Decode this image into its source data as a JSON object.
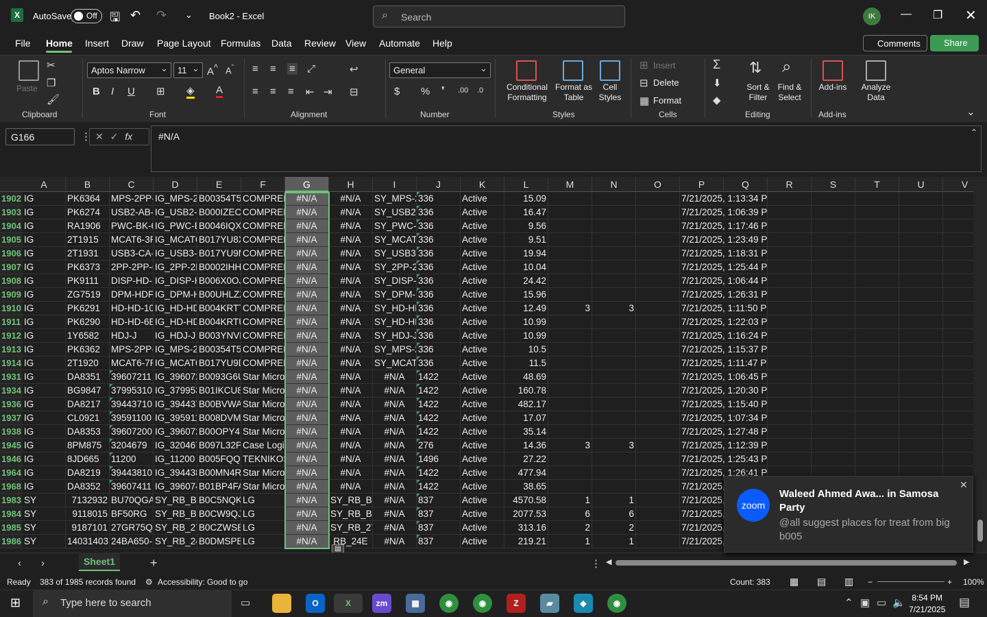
{
  "titlebar": {
    "autosave_label": "AutoSave",
    "autosave_state": "Off",
    "doc_title": "Book2 - Excel",
    "search_placeholder": "Search",
    "avatar_initials": "IK"
  },
  "menu": {
    "items": [
      "File",
      "Home",
      "Insert",
      "Draw",
      "Page Layout",
      "Formulas",
      "Data",
      "Review",
      "View",
      "Automate",
      "Help"
    ],
    "comments": "Comments",
    "share": "Share"
  },
  "ribbon": {
    "clipboard": {
      "label": "Clipboard",
      "paste": "Paste"
    },
    "font": {
      "label": "Font",
      "name": "Aptos Narrow",
      "size": "11"
    },
    "alignment": {
      "label": "Alignment"
    },
    "number": {
      "label": "Number",
      "format": "General"
    },
    "styles": {
      "label": "Styles",
      "conditional": "Conditional Formatting",
      "format_table": "Format as Table",
      "cell_styles": "Cell Styles"
    },
    "cells": {
      "label": "Cells",
      "insert": "Insert",
      "delete": "Delete",
      "format": "Format"
    },
    "editing": {
      "label": "Editing",
      "sort": "Sort & Filter",
      "find": "Find & Select"
    },
    "addins": {
      "label": "Add-ins",
      "addins": "Add-ins",
      "analyze": "Analyze Data"
    }
  },
  "formula_bar": {
    "name_box": "G166",
    "fx": "fx",
    "formula": "#N/A"
  },
  "columns": [
    "A",
    "B",
    "C",
    "D",
    "E",
    "F",
    "G",
    "H",
    "I",
    "J",
    "K",
    "L",
    "M",
    "N",
    "O",
    "P",
    "Q",
    "R",
    "S",
    "T",
    "U",
    "V"
  ],
  "rows": [
    {
      "n": "1902",
      "a": "IG",
      "b": "PK6364",
      "c": "MPS-2PP-2",
      "d": "IG_MPS-2P",
      "e": "B00354T5U",
      "f": "COMPREH",
      "g": "#N/A",
      "h": "#N/A",
      "i": "SY_MPS-2P",
      "j": "336",
      "k": "Active",
      "l": "15.09",
      "m": "",
      "nn": "",
      "p": "7/21/2025, 1:13:34 PM"
    },
    {
      "n": "1903",
      "a": "IG",
      "b": "PK6274",
      "c": "USB2-AB-2",
      "d": "IG_USB2-A",
      "e": "B000IZECH",
      "f": "COMPREH",
      "g": "#N/A",
      "h": "#N/A",
      "i": "SY_USB2-A",
      "j": "336",
      "k": "Active",
      "l": "16.47",
      "m": "",
      "nn": "",
      "p": "7/21/2025, 1:06:39 PM"
    },
    {
      "n": "1904",
      "a": "IG",
      "b": "RA1906",
      "c": "PWC-BK-6",
      "d": "IG_PWC-B",
      "e": "B0046IQXI",
      "f": "COMPREH",
      "g": "#N/A",
      "h": "#N/A",
      "i": "SY_PWC-B",
      "j": "336",
      "k": "Active",
      "l": "9.56",
      "m": "",
      "nn": "",
      "p": "7/21/2025, 1:17:46 PM"
    },
    {
      "n": "1905",
      "a": "IG",
      "b": "2T1915",
      "c": "MCAT6-3P",
      "d": "IG_MCAT6",
      "e": "B017YU8X",
      "f": "COMPREH",
      "g": "#N/A",
      "h": "#N/A",
      "i": "SY_MCAT6",
      "j": "336",
      "k": "Active",
      "l": "9.51",
      "m": "",
      "nn": "",
      "p": "7/21/2025, 1:23:49 PM"
    },
    {
      "n": "1906",
      "a": "IG",
      "b": "2T1931",
      "c": "USB3-CA-1",
      "d": "IG_USB3-C",
      "e": "B017YU9M",
      "f": "COMPREH",
      "g": "#N/A",
      "h": "#N/A",
      "i": "SY_USB3-C",
      "j": "336",
      "k": "Active",
      "l": "19.94",
      "m": "",
      "nn": "",
      "p": "7/21/2025, 1:18:31 PM"
    },
    {
      "n": "1907",
      "a": "IG",
      "b": "PK6373",
      "c": "2PP-2PP-6",
      "d": "IG_2PP-2P",
      "e": "B0002IHHI",
      "f": "COMPREH",
      "g": "#N/A",
      "h": "#N/A",
      "i": "SY_2PP-2P",
      "j": "336",
      "k": "Active",
      "l": "10.04",
      "m": "",
      "nn": "",
      "p": "7/21/2025, 1:25:44 PM"
    },
    {
      "n": "1908",
      "a": "IG",
      "b": "PK9111",
      "c": "DISP-HD-1",
      "d": "IG_DISP-H",
      "e": "B006X0OJ",
      "f": "COMPREH",
      "g": "#N/A",
      "h": "#N/A",
      "i": "SY_DISP-H",
      "j": "336",
      "k": "Active",
      "l": "24.42",
      "m": "",
      "nn": "",
      "p": "7/21/2025, 1:06:44 PM"
    },
    {
      "n": "1909",
      "a": "IG",
      "b": "ZG7519",
      "c": "DPM-HDF",
      "d": "IG_DPM-H",
      "e": "B00UHLZZ",
      "f": "COMPREH",
      "g": "#N/A",
      "h": "#N/A",
      "i": "SY_DPM-H",
      "j": "336",
      "k": "Active",
      "l": "15.96",
      "m": "",
      "nn": "",
      "p": "7/21/2025, 1:26:31 PM"
    },
    {
      "n": "1910",
      "a": "IG",
      "b": "PK6291",
      "c": "HD-HD-10",
      "d": "IG_HD-HD",
      "e": "B004KRTT",
      "f": "COMPREH",
      "g": "#N/A",
      "h": "#N/A",
      "i": "SY_HD-HD",
      "j": "336",
      "k": "Active",
      "l": "12.49",
      "m": "3",
      "nn": "3",
      "p": "7/21/2025, 1:11:50 PM"
    },
    {
      "n": "1911",
      "a": "IG",
      "b": "PK6290",
      "c": "HD-HD-6E",
      "d": "IG_HD-HD",
      "e": "B004KRTU",
      "f": "COMPREH",
      "g": "#N/A",
      "h": "#N/A",
      "i": "SY_HD-HD",
      "j": "336",
      "k": "Active",
      "l": "10.99",
      "m": "",
      "nn": "",
      "p": "7/21/2025, 1:22:03 PM"
    },
    {
      "n": "1912",
      "a": "IG",
      "b": "1Y6582",
      "c": "HDJ-J",
      "d": "IG_HDJ-J",
      "e": "B003YNVP",
      "f": "COMPREH",
      "g": "#N/A",
      "h": "#N/A",
      "i": "SY_HDJ-J",
      "j": "336",
      "k": "Active",
      "l": "10.99",
      "m": "",
      "nn": "",
      "p": "7/21/2025, 1:16:24 PM"
    },
    {
      "n": "1913",
      "a": "IG",
      "b": "PK6362",
      "c": "MPS-2PP-(",
      "d": "IG_MPS-2P",
      "e": "B00354T5U",
      "f": "COMPREH",
      "g": "#N/A",
      "h": "#N/A",
      "i": "SY_MPS-2P",
      "j": "336",
      "k": "Active",
      "l": "10.5",
      "m": "",
      "nn": "",
      "p": "7/21/2025, 1:15:37 PM"
    },
    {
      "n": "1914",
      "a": "IG",
      "b": "2T1920",
      "c": "MCAT6-7P",
      "d": "IG_MCAT6",
      "e": "B017YU9D",
      "f": "COMPREH",
      "g": "#N/A",
      "h": "#N/A",
      "i": "SY_MCAT6",
      "j": "336",
      "k": "Active",
      "l": "11.5",
      "m": "",
      "nn": "",
      "p": "7/21/2025, 1:11:47 PM"
    },
    {
      "n": "1931",
      "a": "IG",
      "b": "DA8351",
      "c": "39607211",
      "d": "IG_396072",
      "e": "B0093G6U",
      "f": "Star Micro",
      "g": "#N/A",
      "h": "#N/A",
      "i": "#N/A",
      "j": "1422",
      "k": "Active",
      "l": "48.69",
      "m": "",
      "nn": "",
      "p": "7/21/2025, 1:06:45 PM"
    },
    {
      "n": "1934",
      "a": "IG",
      "b": "BG9847",
      "c": "37995310",
      "d": "IG_379953",
      "e": "B01IKCU8",
      "f": "Star Micro",
      "g": "#N/A",
      "h": "#N/A",
      "i": "#N/A",
      "j": "1422",
      "k": "Active",
      "l": "160.78",
      "m": "",
      "nn": "",
      "p": "7/21/2025, 1:20:30 PM"
    },
    {
      "n": "1936",
      "a": "IG",
      "b": "DA8217",
      "c": "39443710",
      "d": "IG_394437",
      "e": "B00BVWA",
      "f": "Star Micro",
      "g": "#N/A",
      "h": "#N/A",
      "i": "#N/A",
      "j": "1422",
      "k": "Active",
      "l": "482.17",
      "m": "",
      "nn": "",
      "p": "7/21/2025, 1:15:40 PM"
    },
    {
      "n": "1937",
      "a": "IG",
      "b": "CL0921",
      "c": "39591100",
      "d": "IG_395911",
      "e": "B008DVMI",
      "f": "Star Micro",
      "g": "#N/A",
      "h": "#N/A",
      "i": "#N/A",
      "j": "1422",
      "k": "Active",
      "l": "17.07",
      "m": "",
      "nn": "",
      "p": "7/21/2025, 1:07:34 PM"
    },
    {
      "n": "1938",
      "a": "IG",
      "b": "DA8353",
      "c": "39607200",
      "d": "IG_396072",
      "e": "B00OPY4K",
      "f": "Star Micro",
      "g": "#N/A",
      "h": "#N/A",
      "i": "#N/A",
      "j": "1422",
      "k": "Active",
      "l": "35.14",
      "m": "",
      "nn": "",
      "p": "7/21/2025, 1:27:48 PM"
    },
    {
      "n": "1945",
      "a": "IG",
      "b": "8PM875",
      "c": "3204679",
      "d": "IG_320467",
      "e": "B097L32P",
      "f": "Case Logi",
      "g": "#N/A",
      "h": "#N/A",
      "i": "#N/A",
      "j": "276",
      "k": "Active",
      "l": "14.36",
      "m": "3",
      "nn": "3",
      "p": "7/21/2025, 1:12:39 PM"
    },
    {
      "n": "1946",
      "a": "IG",
      "b": "8JD665",
      "c": "11200",
      "d": "IG_11200",
      "e": "B005FQQS",
      "f": "TEKNIKOS",
      "g": "#N/A",
      "h": "#N/A",
      "i": "#N/A",
      "j": "1496",
      "k": "Active",
      "l": "27.22",
      "m": "",
      "nn": "",
      "p": "7/21/2025, 1:25:43 PM"
    },
    {
      "n": "1964",
      "a": "IG",
      "b": "DA8219",
      "c": "39443810",
      "d": "IG_394438",
      "e": "B00MN4R",
      "f": "Star Micro",
      "g": "#N/A",
      "h": "#N/A",
      "i": "#N/A",
      "j": "1422",
      "k": "Active",
      "l": "477.94",
      "m": "",
      "nn": "",
      "p": "7/21/2025, 1:26:41 PM"
    },
    {
      "n": "1968",
      "a": "IG",
      "b": "DA8352",
      "c": "39607411",
      "d": "IG_396074",
      "e": "B01BP4FA",
      "f": "Star Micro",
      "g": "#N/A",
      "h": "#N/A",
      "i": "#N/A",
      "j": "1422",
      "k": "Active",
      "l": "38.65",
      "m": "",
      "nn": "",
      "p": "7/21/2025,"
    },
    {
      "n": "1983",
      "a": "SY",
      "b": "7132932",
      "c": "BU70QGA",
      "d": "SY_RB_BU",
      "e": "B0C5NQKI",
      "f": "LG",
      "g": "#N/A",
      "h": "SY_RB_BU",
      "i": "#N/A",
      "j": "837",
      "k": "Active",
      "l": "4570.58",
      "m": "1",
      "nn": "1",
      "p": "7/21/2025,"
    },
    {
      "n": "1984",
      "a": "SY",
      "b": "9118015",
      "c": "BF50RG",
      "d": "SY_RB_BF5",
      "e": "B0CW9QJ",
      "f": "LG",
      "g": "#N/A",
      "h": "SY_RB_BF5",
      "i": "#N/A",
      "j": "837",
      "k": "Active",
      "l": "2077.53",
      "m": "6",
      "nn": "6",
      "p": "7/21/2025,"
    },
    {
      "n": "1985",
      "a": "SY",
      "b": "9187101",
      "c": "27GR75QE",
      "d": "SY_RB_27C",
      "e": "B0CZWSB1",
      "f": "LG",
      "g": "#N/A",
      "h": "SY_RB_27C",
      "i": "#N/A",
      "j": "837",
      "k": "Active",
      "l": "313.16",
      "m": "2",
      "nn": "2",
      "p": "7/21/2025,"
    },
    {
      "n": "1986",
      "a": "SY",
      "b": "14031403",
      "c": "24BA650-E",
      "d": "SY_RB_24E",
      "e": "B0DMSPB",
      "f": "LG",
      "g": "#N/A",
      "h": "RB_24E",
      "i": "#N/A",
      "j": "837",
      "k": "Active",
      "l": "219.21",
      "m": "1",
      "nn": "1",
      "p": "7/21/2025,"
    }
  ],
  "sheet": {
    "tab": "Sheet1",
    "add": "+"
  },
  "status": {
    "ready": "Ready",
    "records": "383 of 1985 records found",
    "accessibility": "Accessibility: Good to go",
    "count": "Count: 383",
    "zoom": "100%"
  },
  "taskbar": {
    "search": "Type here to search",
    "time": "8:54 PM",
    "date": "7/21/2025"
  },
  "toast": {
    "app": "zoom",
    "title": "Waleed Ahmed Awa... in Samosa Party",
    "message": "@all suggest places for treat from big b005"
  }
}
